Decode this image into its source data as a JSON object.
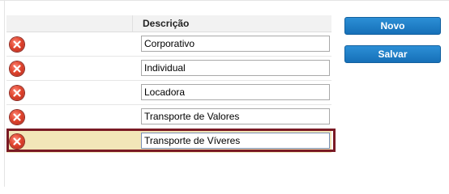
{
  "grid": {
    "header": {
      "description_label": "Descrição"
    },
    "rows": [
      {
        "value": "Corporativo",
        "selected": false
      },
      {
        "value": "Individual",
        "selected": false
      },
      {
        "value": "Locadora",
        "selected": false
      },
      {
        "value": "Transporte de Valores",
        "selected": false
      },
      {
        "value": "Transporte de Víveres",
        "selected": true
      }
    ]
  },
  "actions": {
    "new_label": "Novo",
    "save_label": "Salvar"
  },
  "colors": {
    "button_blue": "#1670b8",
    "selected_row_bg": "#f2e6b8",
    "selected_row_border": "#7a1a24",
    "delete_icon_red": "#e0452e"
  }
}
